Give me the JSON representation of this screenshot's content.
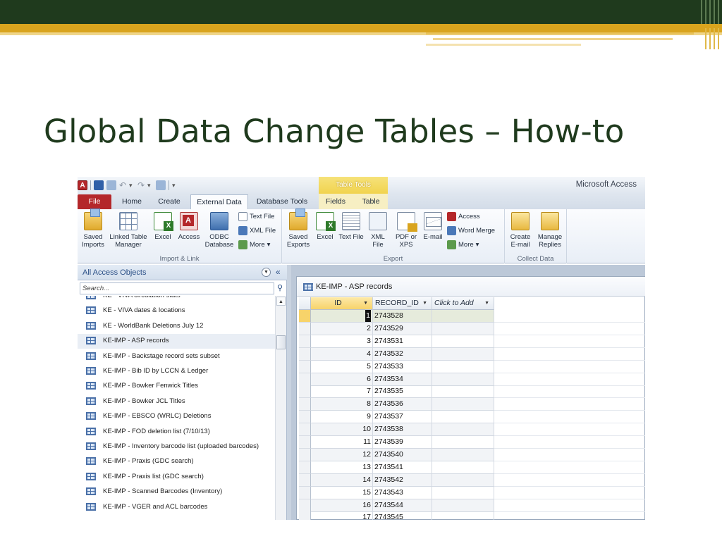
{
  "slide": {
    "title": "Global Data Change Tables – How-to"
  },
  "access": {
    "app_title": "Microsoft Access",
    "contextual_header": "Table Tools",
    "tabs": [
      "File",
      "Home",
      "Create",
      "External Data",
      "Database Tools",
      "Fields",
      "Table"
    ],
    "active_tab": "External Data",
    "ribbon": {
      "import_link": {
        "label": "Import & Link",
        "saved_imports": "Saved Imports",
        "linked_table_manager": "Linked Table Manager",
        "excel": "Excel",
        "access": "Access",
        "odbc": "ODBC Database",
        "text_file": "Text File",
        "xml_file": "XML File",
        "more": "More"
      },
      "export": {
        "label": "Export",
        "saved_exports": "Saved Exports",
        "excel": "Excel",
        "text_file": "Text File",
        "xml_file": "XML File",
        "pdf": "PDF or XPS",
        "email": "E-mail",
        "access": "Access",
        "word_merge": "Word Merge",
        "more": "More"
      },
      "collect": {
        "label": "Collect Data",
        "create_email": "Create E-mail",
        "manage_replies": "Manage Replies"
      }
    },
    "nav": {
      "title": "All Access Objects",
      "search_placeholder": "Search...",
      "items": [
        "KE - VIVA circulation stats",
        "KE - VIVA dates & locations",
        "KE - WorldBank Deletions July 12",
        "KE-IMP - ASP records",
        "KE-IMP - Backstage record sets subset",
        "KE-IMP - Bib ID by LCCN & Ledger",
        "KE-IMP - Bowker Fenwick Titles",
        "KE-IMP - Bowker JCL Titles",
        "KE-IMP - EBSCO (WRLC) Deletions",
        "KE-IMP - FOD deletion list (7/10/13)",
        "KE-IMP - Inventory barcode list (uploaded barcodes)",
        "KE-IMP - Praxis (GDC search)",
        "KE-IMP - Praxis list (GDC search)",
        "KE-IMP - Scanned Barcodes (Inventory)",
        "KE-IMP - VGER and ACL barcodes"
      ],
      "selected": "KE-IMP - ASP records"
    },
    "datasheet": {
      "tab_title": "KE-IMP - ASP records",
      "columns": [
        "ID",
        "RECORD_ID",
        "Click to Add"
      ],
      "rows": [
        [
          "1",
          "2743528"
        ],
        [
          "2",
          "2743529"
        ],
        [
          "3",
          "2743531"
        ],
        [
          "4",
          "2743532"
        ],
        [
          "5",
          "2743533"
        ],
        [
          "6",
          "2743534"
        ],
        [
          "7",
          "2743535"
        ],
        [
          "8",
          "2743536"
        ],
        [
          "9",
          "2743537"
        ],
        [
          "10",
          "2743538"
        ],
        [
          "11",
          "2743539"
        ],
        [
          "12",
          "2743540"
        ],
        [
          "13",
          "2743541"
        ],
        [
          "14",
          "2743542"
        ],
        [
          "15",
          "2743543"
        ],
        [
          "16",
          "2743544"
        ],
        [
          "17",
          "2743545"
        ]
      ]
    }
  }
}
